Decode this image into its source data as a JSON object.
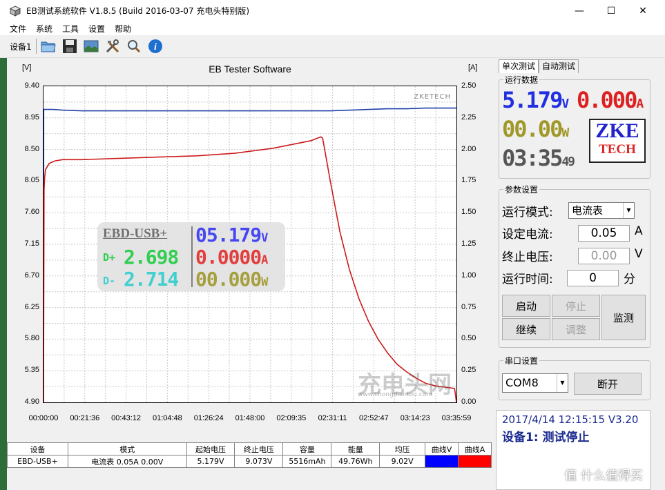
{
  "window": {
    "title": "EB测试系统软件 V1.8.5 (Build 2016-03-07 充电头特别版)",
    "minimize": "—",
    "maximize": "☐",
    "close": "✕"
  },
  "menu": [
    "文件",
    "系统",
    "工具",
    "设置",
    "帮助"
  ],
  "toolbar": {
    "device_label": "设备1",
    "icons": [
      "folder-icon",
      "save-icon",
      "image-icon",
      "tools-icon",
      "search-icon",
      "info-icon"
    ]
  },
  "chart_data": {
    "type": "line",
    "title": "EB Tester Software",
    "y_left_unit": "[V]",
    "y_right_unit": "[A]",
    "y_left_ticks": [
      "9.40",
      "8.95",
      "8.50",
      "8.05",
      "7.60",
      "7.15",
      "6.70",
      "6.25",
      "5.80",
      "5.35",
      "4.90"
    ],
    "y_right_ticks": [
      "2.50",
      "2.25",
      "2.00",
      "1.75",
      "1.50",
      "1.25",
      "1.00",
      "0.75",
      "0.50",
      "0.25",
      "0.00"
    ],
    "x_ticks": [
      "00:00:00",
      "00:21:36",
      "00:43:12",
      "01:04:48",
      "01:26:24",
      "01:48:00",
      "02:09:35",
      "02:31:11",
      "02:52:47",
      "03:14:23",
      "03:35:59"
    ],
    "ylim_left": [
      4.9,
      9.4
    ],
    "ylim_right": [
      0,
      2.5
    ],
    "x_range_min": [
      0,
      215.98
    ],
    "grid": true,
    "series": [
      {
        "axis": "left",
        "color": "#1f3fa8",
        "x": [
          0,
          0.1,
          0.2,
          5,
          10,
          20,
          40,
          60,
          80,
          100,
          120,
          140,
          150,
          160,
          170,
          180,
          190,
          200,
          215.98
        ],
        "y": [
          4.9,
          9.07,
          9.07,
          9.07,
          9.06,
          9.05,
          9.05,
          9.05,
          9.05,
          9.05,
          9.05,
          9.05,
          9.05,
          9.06,
          9.07,
          9.08,
          9.08,
          9.09,
          9.09
        ]
      },
      {
        "axis": "right",
        "color": "#cc1a1a",
        "x": [
          0,
          0.3,
          0.6,
          1,
          3,
          6,
          10,
          20,
          40,
          60,
          80,
          100,
          120,
          130,
          140,
          145,
          146,
          150,
          155,
          160,
          165,
          170,
          175,
          180,
          185,
          190,
          195,
          200,
          205,
          210,
          215,
          215.98
        ],
        "y": [
          0,
          1.68,
          1.78,
          1.84,
          1.89,
          1.91,
          1.92,
          1.92,
          1.93,
          1.94,
          1.95,
          1.97,
          2.01,
          2.04,
          2.07,
          2.1,
          2.09,
          1.75,
          1.35,
          1.05,
          0.82,
          0.64,
          0.5,
          0.39,
          0.3,
          0.24,
          0.19,
          0.15,
          0.13,
          0.12,
          0.11,
          0.0
        ]
      }
    ]
  },
  "watermarks": {
    "zketech": "ZKETECH",
    "site_big": "充电头网",
    "site_url": "www.chongdiantou.com"
  },
  "overlay": {
    "name": "EBD-USB+",
    "dplus_label": "D+",
    "dplus_value": "2.698",
    "dminus_label": "D-",
    "dminus_value": "2.714",
    "voltage": "05.179",
    "voltage_unit": "V",
    "current": "0.0000",
    "current_unit": "A",
    "power": "00.000",
    "power_unit": "W"
  },
  "table": {
    "headers": [
      "设备",
      "模式",
      "起始电压",
      "终止电压",
      "容量",
      "能量",
      "均压",
      "曲线V",
      "曲线A"
    ],
    "row": [
      "EBD-USB+",
      "电流表  0.05A  0.00V",
      "5.179V",
      "9.073V",
      "5516mAh",
      "49.76Wh",
      "9.02V"
    ],
    "curve_v_color": "#0000ff",
    "curve_a_color": "#ff0000"
  },
  "right_panel": {
    "tabs": [
      "单次测试",
      "自动测试"
    ],
    "run_data": {
      "label": "运行数据",
      "voltage": "5.179",
      "voltage_unit": "V",
      "current": "0.000",
      "current_unit": "A",
      "power": "00.00",
      "power_unit": "W",
      "time": "03:35",
      "time_sec": "49",
      "logo1": "ZKE",
      "logo2": "TECH"
    },
    "params": {
      "label": "参数设置",
      "mode_label": "运行模式:",
      "mode_value": "电流表",
      "current_label": "设定电流:",
      "current_value": "0.05",
      "current_unit": "A",
      "stopv_label": "终止电压:",
      "stopv_value": "0.00",
      "stopv_unit": "V",
      "time_label": "运行时间:",
      "time_value": "0",
      "time_unit": "分",
      "buttons": {
        "start": "启动",
        "stop": "停止",
        "continue": "继续",
        "adjust": "调整",
        "monitor": "监测"
      }
    },
    "serial": {
      "label": "串口设置",
      "port": "COM8",
      "disconnect": "断开"
    },
    "status": {
      "line1": "2017/4/14 12:15:15  V3.20",
      "line2": "设备1: 测试停止"
    },
    "corner_watermark": "值 什么值得买"
  }
}
